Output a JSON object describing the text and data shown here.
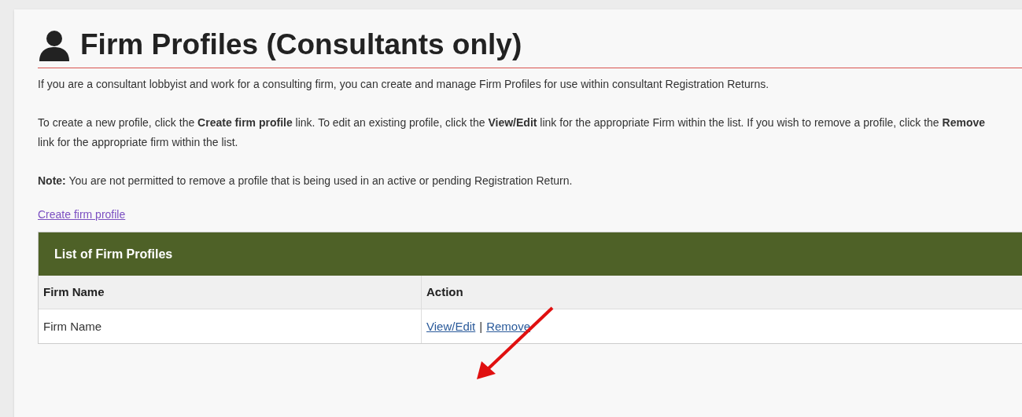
{
  "title": "Firm Profiles (Consultants only)",
  "paragraphs": [
    "If you are a consultant lobbyist and work for a consulting firm, you can create and manage Firm Profiles for use within consultant Registration Returns.",
    "To create a new profile, click the **Create firm profile** link. To edit an existing profile, click the **View/Edit** link for the appropriate Firm within the list. If you wish to remove a profile, click the **Remove** link for the appropriate firm within the list.",
    "**Note:** You are not permitted to remove a profile that is being used in an active or pending Registration Return."
  ],
  "create_link": "Create firm profile",
  "table": {
    "title": "List of Firm Profiles",
    "columns": [
      "Firm Name",
      "Action"
    ],
    "rows": [
      {
        "firm_name": "Firm Name",
        "actions": [
          "View/Edit",
          "Remove"
        ],
        "separator": "|"
      }
    ]
  }
}
